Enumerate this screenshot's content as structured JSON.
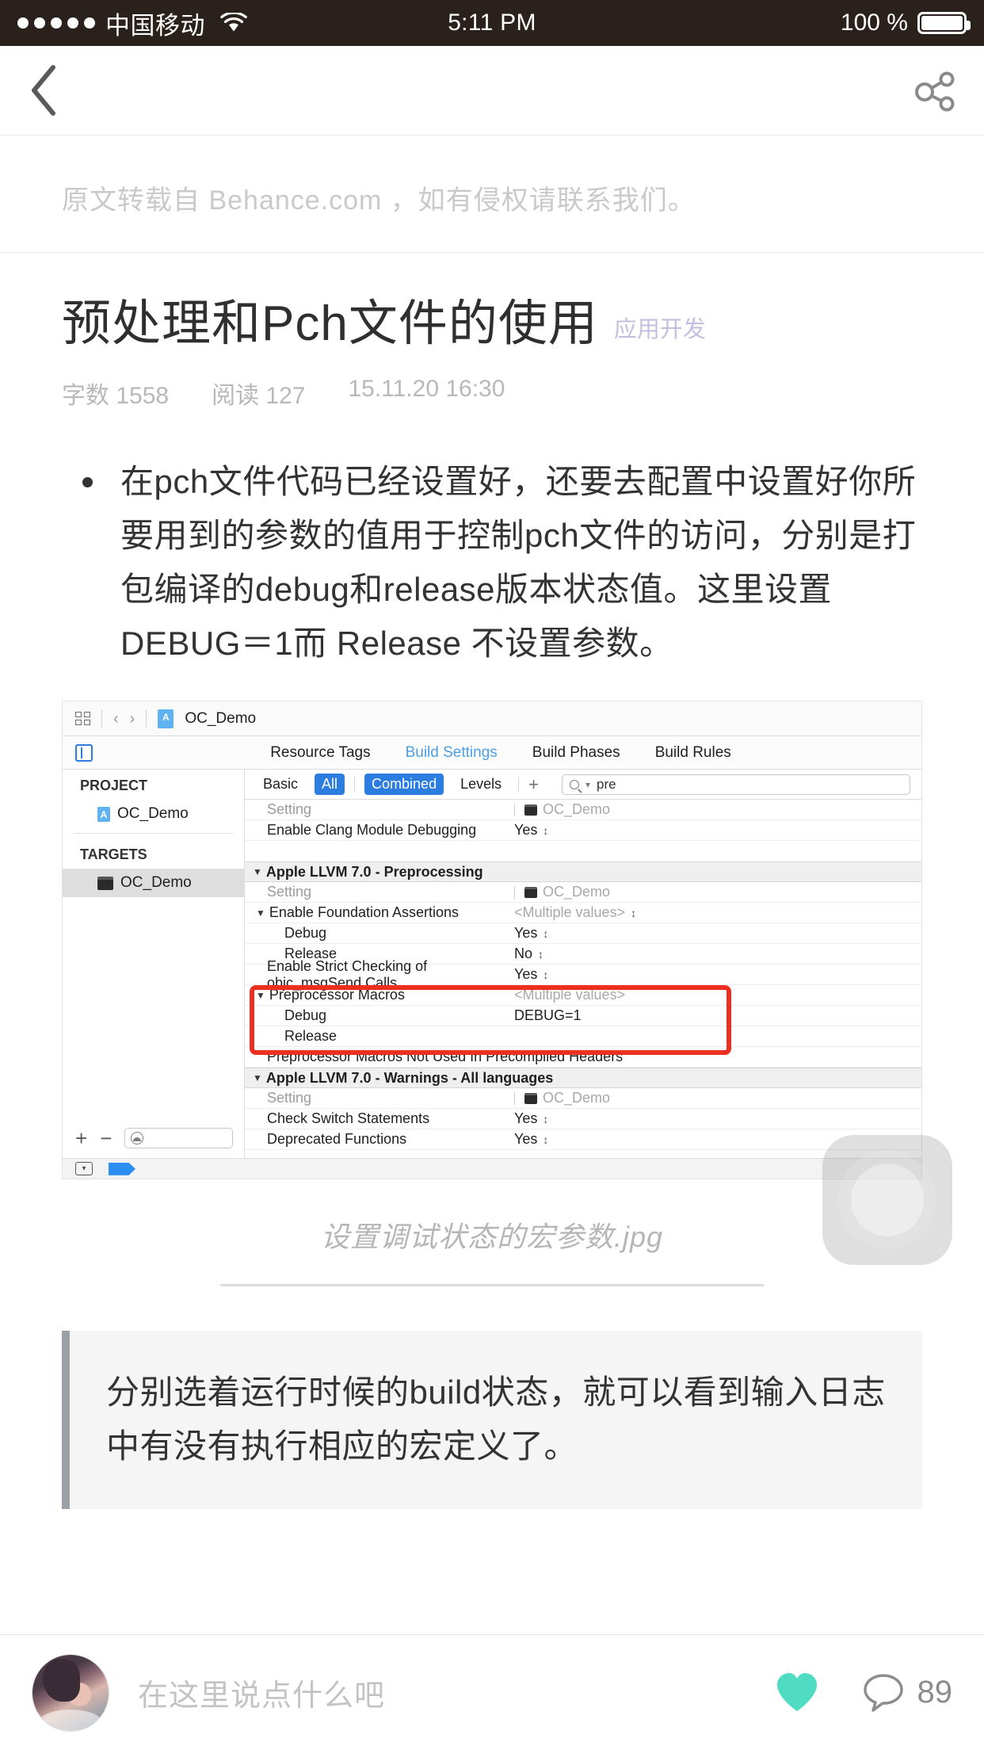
{
  "statusbar": {
    "carrier": "中国移动",
    "signal_dots": 5,
    "wifi_icon": "wifi-icon",
    "time": "5:11 PM",
    "battery_percent": "100 %",
    "battery_icon": "battery-full-icon"
  },
  "navbar": {
    "back_icon": "chevron-left-icon",
    "share_icon": "share-icon"
  },
  "source_note": "原文转载自 Behance.com ，如有侵权请联系我们。",
  "article": {
    "title": "预处理和Pch文件的使用",
    "tag": "应用开发",
    "meta": {
      "word_count": "字数 1558",
      "read_count": "阅读 127",
      "date": "15.11.20 16:30"
    },
    "bullets": [
      "在pch文件代码已经设置好，还要去配置中设置好你所要用到的参数的值用于控制pch文件的访问，分别是打包编译的debug和release版本状态值。这里设置DEBUG＝1而 Release 不设置参数。"
    ],
    "image_caption": "设置调试状态的宏参数.jpg",
    "quote": "分别选着运行时候的build状态，就可以看到输入日志中有没有执行相应的宏定义了。"
  },
  "xcode": {
    "toolbar": {
      "grid_icon": "grid-icon",
      "back_icon": "chevron-left-icon",
      "forward_icon": "chevron-right-icon",
      "file_icon": "xcode-project-icon",
      "breadcrumb": "OC_Demo"
    },
    "editor_toggle_icon": "editor-layout-icon",
    "tabs": [
      {
        "label": "Resource Tags",
        "active": false
      },
      {
        "label": "Build Settings",
        "active": true
      },
      {
        "label": "Build Phases",
        "active": false
      },
      {
        "label": "Build Rules",
        "active": false
      }
    ],
    "sidebar": {
      "project_header": "PROJECT",
      "project_item": "OC_Demo",
      "targets_header": "TARGETS",
      "target_item": "OC_Demo",
      "add_label": "+",
      "remove_label": "−",
      "filter_placeholder": "",
      "filter_icon": "filter-icon"
    },
    "filterbar": {
      "segments": [
        {
          "label": "Basic",
          "active": false
        },
        {
          "label": "All",
          "active": true
        },
        {
          "label": "Combined",
          "active": true
        },
        {
          "label": "Levels",
          "active": false
        }
      ],
      "add_label": "+",
      "search_icon": "search-icon",
      "search_value": "pre"
    },
    "rows": [
      {
        "type": "header",
        "indent": 1,
        "name": "Setting",
        "value": "OC_Demo",
        "value_icon": "target-icon"
      },
      {
        "type": "setting",
        "indent": 1,
        "name": "Enable Clang Module Debugging",
        "value": "Yes",
        "stepper": true
      },
      {
        "type": "spacer",
        "indent": 0,
        "name": "",
        "value": ""
      },
      {
        "type": "group",
        "indent": 0,
        "name": "Apple LLVM 7.0 - Preprocessing",
        "value": ""
      },
      {
        "type": "header",
        "indent": 1,
        "name": "Setting",
        "value": "OC_Demo",
        "value_icon": "target-icon"
      },
      {
        "type": "parent",
        "indent": 1,
        "name": "Enable Foundation Assertions",
        "value": "<Multiple values>",
        "stepper": true,
        "dim": true
      },
      {
        "type": "setting",
        "indent": 2,
        "name": "Debug",
        "value": "Yes",
        "stepper": true
      },
      {
        "type": "setting",
        "indent": 2,
        "name": "Release",
        "value": "No",
        "stepper": true
      },
      {
        "type": "setting",
        "indent": 1,
        "name": "Enable Strict Checking of objc_msgSend Calls",
        "value": "Yes",
        "stepper": true
      },
      {
        "type": "parent",
        "indent": 1,
        "name": "Preprocessor Macros",
        "value": "<Multiple values>",
        "stepper": false,
        "dim": true
      },
      {
        "type": "setting",
        "indent": 2,
        "name": "Debug",
        "value": "DEBUG=1"
      },
      {
        "type": "setting",
        "indent": 2,
        "name": "Release",
        "value": ""
      },
      {
        "type": "setting",
        "indent": 1,
        "name": "Preprocessor Macros Not Used In Precompiled Headers",
        "value": ""
      },
      {
        "type": "group",
        "indent": 0,
        "name": "Apple LLVM 7.0 - Warnings - All languages",
        "value": ""
      },
      {
        "type": "header",
        "indent": 1,
        "name": "Setting",
        "value": "OC_Demo",
        "value_icon": "target-icon"
      },
      {
        "type": "setting",
        "indent": 1,
        "name": "Check Switch Statements",
        "value": "Yes",
        "stepper": true
      },
      {
        "type": "setting",
        "indent": 1,
        "name": "Deprecated Functions",
        "value": "Yes",
        "stepper": true
      }
    ],
    "highlight_color": "#ec2f1e",
    "bottombar": {
      "filter_icon": "filter-dropdown-icon",
      "tag_icon": "blue-tag-icon"
    }
  },
  "bottombar": {
    "avatar": "user-avatar",
    "comment_placeholder": "在这里说点什么吧",
    "like_icon": "heart-icon",
    "like_color": "#4fdcc3",
    "comment_icon": "comment-icon",
    "comment_count": "89"
  },
  "assistive_touch": "assistive-touch-button"
}
